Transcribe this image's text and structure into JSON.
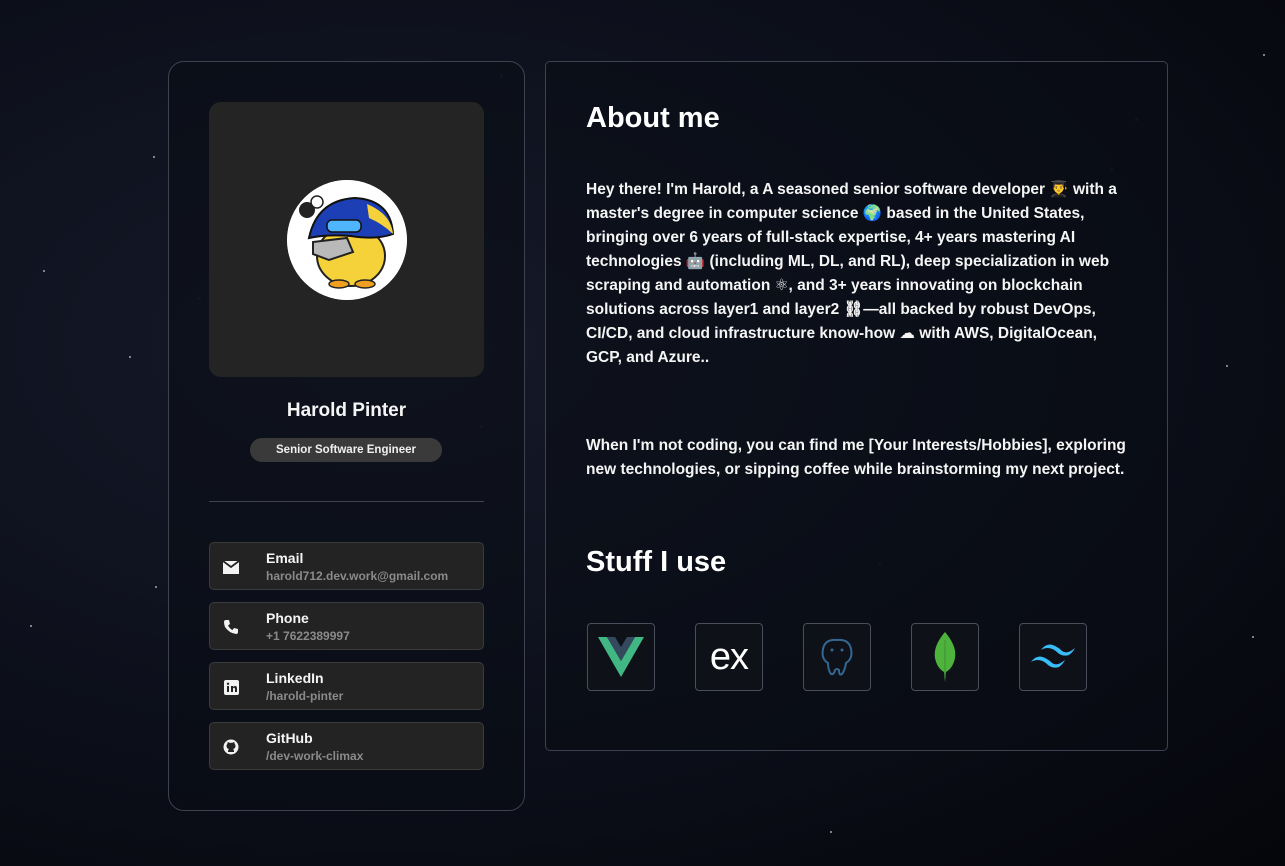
{
  "profile": {
    "name": "Harold Pinter",
    "role": "Senior Software Engineer",
    "contacts": [
      {
        "label": "Email",
        "value": "harold712.dev.work@gmail.com",
        "icon": "envelope-icon"
      },
      {
        "label": "Phone",
        "value": "+1 7622389997",
        "icon": "phone-icon"
      },
      {
        "label": "LinkedIn",
        "value": "/harold-pinter",
        "icon": "linkedin-icon"
      },
      {
        "label": "GitHub",
        "value": "/dev-work-climax",
        "icon": "github-icon"
      }
    ]
  },
  "about": {
    "title": "About me",
    "paragraph1": "Hey there! I'm Harold, a A seasoned senior software developer 👨‍🎓 with a master's degree in computer science 🌍 based in the United States, bringing over 6 years of full-stack expertise, 4+ years mastering AI technologies 🤖 (including ML, DL, and RL), deep specialization in web scraping and automation ⚛, and 3+ years innovating on blockchain solutions across layer1 and layer2 ⛓—all backed by robust DevOps, CI/CD, and cloud infrastructure know-how ☁ with AWS, DigitalOcean, GCP, and Azure..",
    "paragraph2": "When I'm not coding, you can find me [Your Interests/Hobbies], exploring new technologies, or sipping coffee while brainstorming my next project."
  },
  "stack": {
    "title": "Stuff I use",
    "items": [
      {
        "name": "vue-icon",
        "color": "#41b883"
      },
      {
        "name": "express-icon",
        "color": "#ffffff",
        "text": "ex"
      },
      {
        "name": "postgresql-icon",
        "color": "#336791"
      },
      {
        "name": "mongodb-icon",
        "color": "#4db33d"
      },
      {
        "name": "tailwind-icon",
        "color": "#38bdf8"
      }
    ]
  },
  "colors": {
    "background": "#0c0f1a",
    "card_border": "#3d4150",
    "badge": "#3a3a3a"
  }
}
